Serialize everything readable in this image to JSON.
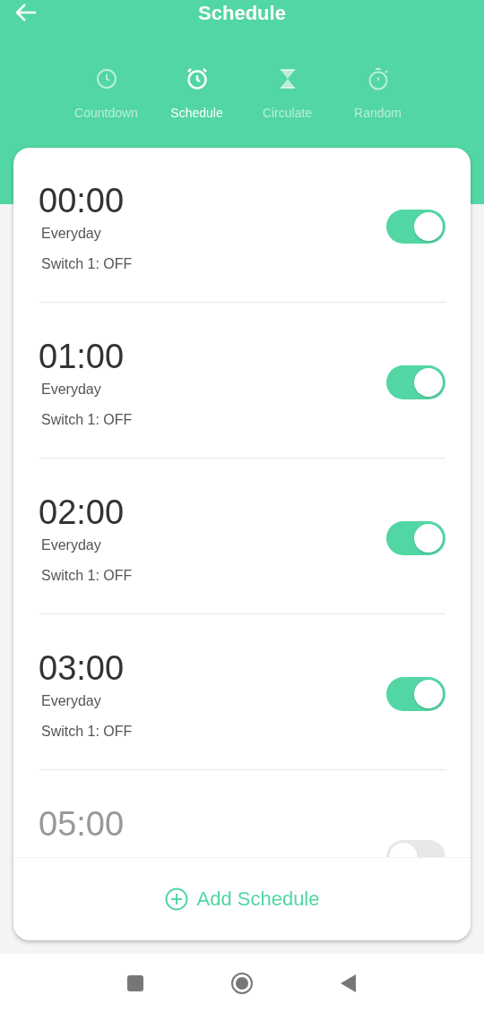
{
  "header": {
    "title": "Schedule"
  },
  "tabs": [
    {
      "kind": "clock",
      "label": "Countdown",
      "selected": false
    },
    {
      "kind": "alarm",
      "label": "Schedule",
      "selected": true
    },
    {
      "kind": "hourglass",
      "label": "Circulate",
      "selected": false
    },
    {
      "kind": "stopwatch",
      "label": "Random",
      "selected": false
    }
  ],
  "schedules": [
    {
      "time": "00:00",
      "repeat": "Everyday",
      "action": "Switch 1: OFF",
      "on": true
    },
    {
      "time": "01:00",
      "repeat": "Everyday",
      "action": "Switch 1: OFF",
      "on": true
    },
    {
      "time": "02:00",
      "repeat": "Everyday",
      "action": "Switch 1: OFF",
      "on": true
    },
    {
      "time": "03:00",
      "repeat": "Everyday",
      "action": "Switch 1: OFF",
      "on": true
    },
    {
      "time": "05:00",
      "on": false
    }
  ],
  "add_button": {
    "label": "Add Schedule"
  }
}
